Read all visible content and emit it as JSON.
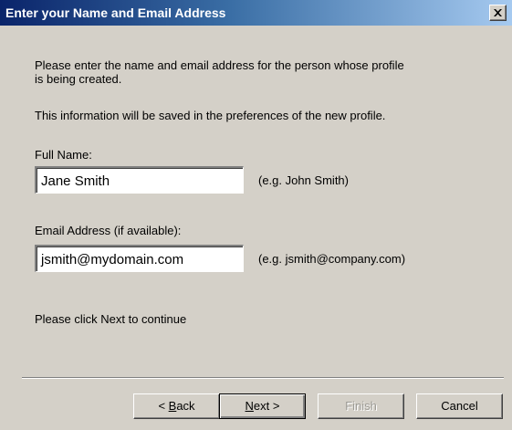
{
  "window": {
    "title": "Enter your Name and Email Address",
    "close_icon": "close-x-icon"
  },
  "intro": {
    "line1": "Please enter the name and email address for the person whose profile",
    "line2": "is being created.",
    "line3": "This information will be saved in the preferences of the new profile."
  },
  "fields": {
    "full_name": {
      "label": "Full Name:",
      "value": "Jane Smith",
      "example": "(e.g. John Smith)"
    },
    "email": {
      "label": "Email Address (if available):",
      "value": "jsmith@mydomain.com",
      "example": "(e.g. jsmith@company.com)"
    }
  },
  "footer_hint": "Please click Next to continue",
  "buttons": {
    "back": {
      "prefix": "< ",
      "accel": "B",
      "rest": "ack"
    },
    "next": {
      "accel": "N",
      "rest": "ext >"
    },
    "finish": {
      "label": "Finish",
      "enabled": false
    },
    "cancel": {
      "label": "Cancel"
    }
  },
  "colors": {
    "titlebar_start": "#0a246a",
    "titlebar_end": "#a6caf0",
    "dialog_face": "#d4d0c8"
  }
}
